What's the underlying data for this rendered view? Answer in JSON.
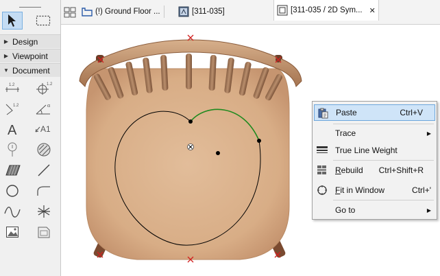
{
  "tabs": [
    {
      "label": "(!) Ground Floor ...",
      "icon": "floor-plan-icon"
    },
    {
      "label": "[311-035]",
      "icon": "object-editor-icon"
    },
    {
      "label": "[311-035 / 2D Sym...",
      "icon": "symbol-window-icon",
      "active": true
    }
  ],
  "toolbox": {
    "sections": [
      {
        "label": "Design",
        "expanded": false
      },
      {
        "label": "Viewpoint",
        "expanded": false
      },
      {
        "label": "Document",
        "expanded": true
      }
    ],
    "tool_labels": {
      "dim": "1.2",
      "angle": "α",
      "label_tool": "A1",
      "text": "A"
    }
  },
  "context_menu": {
    "items": [
      {
        "label": "Paste",
        "shortcut": "Ctrl+V",
        "icon": "clipboard-paste-icon",
        "highlighted": true
      },
      {
        "label": "Trace",
        "shortcut": "",
        "icon": "",
        "submenu": true
      },
      {
        "label": "True Line Weight",
        "shortcut": "",
        "icon": "line-weight-icon"
      },
      {
        "label": "Rebuild",
        "shortcut": "Ctrl+Shift+R",
        "icon": "rebuild-icon"
      },
      {
        "label": "Fit in Window",
        "shortcut": "Ctrl+'",
        "icon": "fit-window-icon"
      },
      {
        "label": "Go to",
        "shortcut": "",
        "icon": "",
        "submenu": true
      }
    ]
  },
  "colors": {
    "accent_highlight": "#cfe4f8",
    "selected_arc": "#1f8a1f",
    "wood": "#d9b28e",
    "hotspot_red": "#d22020"
  }
}
